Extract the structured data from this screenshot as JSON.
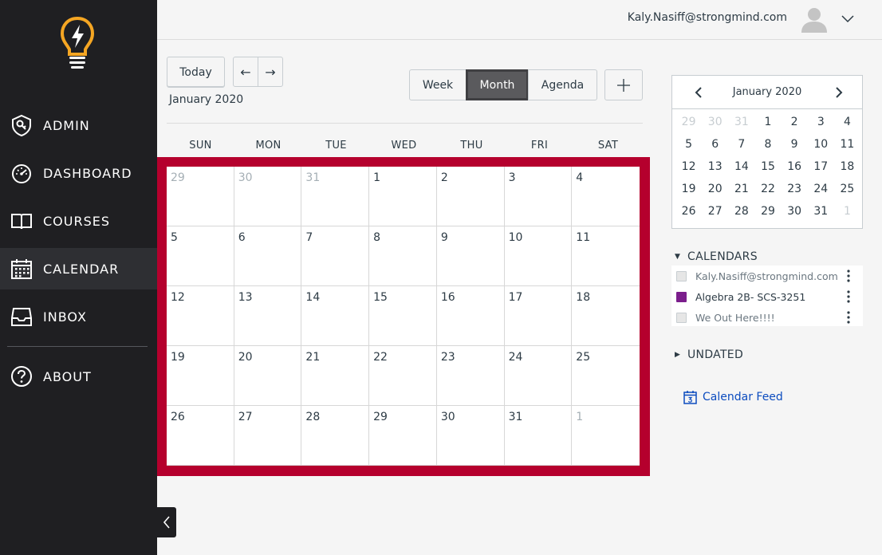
{
  "sidebar": {
    "items": [
      {
        "label": "ADMIN",
        "icon": "admin-shield-icon"
      },
      {
        "label": "DASHBOARD",
        "icon": "speedometer-icon"
      },
      {
        "label": "COURSES",
        "icon": "book-icon"
      },
      {
        "label": "CALENDAR",
        "icon": "calendar-icon",
        "active": true
      },
      {
        "label": "INBOX",
        "icon": "inbox-icon"
      },
      {
        "label": "ABOUT",
        "icon": "question-icon"
      }
    ]
  },
  "header": {
    "user_email": "Kaly.Nasiff@strongmind.com"
  },
  "toolbar": {
    "today_label": "Today",
    "prev_label": "←",
    "next_label": "→",
    "current_month": "January 2020",
    "views": [
      "Week",
      "Month",
      "Agenda"
    ],
    "selected_view": "Month",
    "add_label": "+"
  },
  "calendar": {
    "day_headers": [
      "SUN",
      "MON",
      "TUE",
      "WED",
      "THU",
      "FRI",
      "SAT"
    ],
    "weeks": [
      [
        {
          "d": "29",
          "other": true
        },
        {
          "d": "30",
          "other": true
        },
        {
          "d": "31",
          "other": true
        },
        {
          "d": "1"
        },
        {
          "d": "2"
        },
        {
          "d": "3"
        },
        {
          "d": "4"
        }
      ],
      [
        {
          "d": "5"
        },
        {
          "d": "6"
        },
        {
          "d": "7"
        },
        {
          "d": "8"
        },
        {
          "d": "9"
        },
        {
          "d": "10"
        },
        {
          "d": "11"
        }
      ],
      [
        {
          "d": "12"
        },
        {
          "d": "13"
        },
        {
          "d": "14"
        },
        {
          "d": "15"
        },
        {
          "d": "16"
        },
        {
          "d": "17"
        },
        {
          "d": "18"
        }
      ],
      [
        {
          "d": "19"
        },
        {
          "d": "20"
        },
        {
          "d": "21"
        },
        {
          "d": "22"
        },
        {
          "d": "23"
        },
        {
          "d": "24"
        },
        {
          "d": "25"
        }
      ],
      [
        {
          "d": "26"
        },
        {
          "d": "27"
        },
        {
          "d": "28"
        },
        {
          "d": "29"
        },
        {
          "d": "30"
        },
        {
          "d": "31"
        },
        {
          "d": "1",
          "other": true
        }
      ]
    ],
    "highlight_color": "#b5002d"
  },
  "mini_calendar": {
    "title": "January 2020",
    "days": [
      {
        "d": "29",
        "other": true
      },
      {
        "d": "30",
        "other": true
      },
      {
        "d": "31",
        "other": true
      },
      {
        "d": "1"
      },
      {
        "d": "2"
      },
      {
        "d": "3"
      },
      {
        "d": "4"
      },
      {
        "d": "5"
      },
      {
        "d": "6"
      },
      {
        "d": "7"
      },
      {
        "d": "8"
      },
      {
        "d": "9"
      },
      {
        "d": "10"
      },
      {
        "d": "11"
      },
      {
        "d": "12"
      },
      {
        "d": "13"
      },
      {
        "d": "14"
      },
      {
        "d": "15"
      },
      {
        "d": "16"
      },
      {
        "d": "17"
      },
      {
        "d": "18"
      },
      {
        "d": "19"
      },
      {
        "d": "20"
      },
      {
        "d": "21"
      },
      {
        "d": "22"
      },
      {
        "d": "23"
      },
      {
        "d": "24"
      },
      {
        "d": "25"
      },
      {
        "d": "26"
      },
      {
        "d": "27"
      },
      {
        "d": "28"
      },
      {
        "d": "29"
      },
      {
        "d": "30"
      },
      {
        "d": "31"
      },
      {
        "d": "1",
        "other": true
      }
    ]
  },
  "calendars": {
    "heading": "CALENDARS",
    "items": [
      {
        "name": "Kaly.Nasiff@strongmind.com",
        "color": "#e6e6e6",
        "checked": false,
        "text_color": "#6b7780"
      },
      {
        "name": "Algebra 2B- SCS-3251",
        "color": "#7b1e8c",
        "checked": true,
        "text_color": "#2d3b45"
      },
      {
        "name": "We Out Here!!!!",
        "color": "#e6e6e6",
        "checked": false,
        "text_color": "#6b7780"
      }
    ]
  },
  "undated": {
    "heading": "UNDATED"
  },
  "feed": {
    "label": "Calendar Feed"
  },
  "colors": {
    "sidebar_bg": "#1f1f22",
    "logo_accent": "#f5a623",
    "link": "#0c4cbf",
    "month_active": "#5a5a5d"
  }
}
